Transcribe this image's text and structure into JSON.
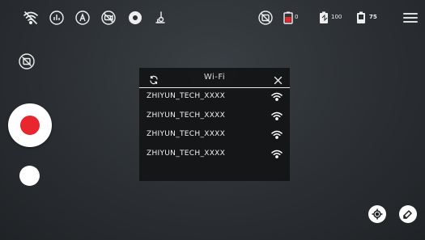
{
  "top_bar": {
    "icons": [
      "wifi-off-icon",
      "audio-levels-icon",
      "auto-mode-icon",
      "camera-off-icon",
      "settings-icon",
      "gimbal-icon",
      "hdr-off-icon"
    ],
    "battery_camera_label": "0",
    "battery_gimbal_label": "100",
    "battery_phone_label": "75"
  },
  "wifi_panel": {
    "title": "Wi-Fi",
    "networks": [
      {
        "name": "ZHIYUN_TECH_XXXX"
      },
      {
        "name": "ZHIYUN_TECH_XXXX"
      },
      {
        "name": "ZHIYUN_TECH_XXXX"
      },
      {
        "name": "ZHIYUN_TECH_XXXX"
      }
    ]
  },
  "controls": {
    "record": "record-button",
    "photo": "photo-button",
    "target": "target-icon",
    "erase": "eraser-icon"
  },
  "colors": {
    "record_red": "#e8262d",
    "panel_bg": "#121315",
    "background": "#2b2f33"
  }
}
